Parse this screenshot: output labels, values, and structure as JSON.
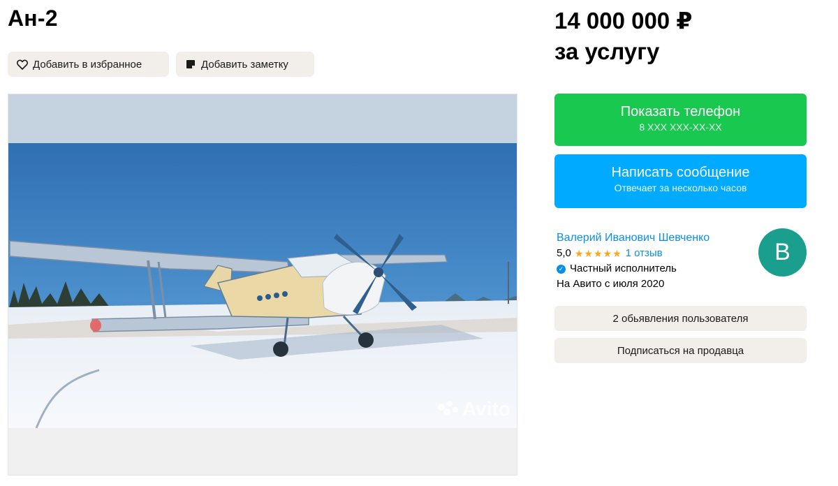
{
  "listing": {
    "title": "Ан-2",
    "favorite_label": "Добавить в избранное",
    "note_label": "Добавить заметку",
    "price_line1": "14 000 000 ₽",
    "price_line2": "за услугу",
    "photo_watermark": "Avito"
  },
  "actions": {
    "show_phone_label": "Показать телефон",
    "phone_masked": "8 XXX XXX-XX-XX",
    "message_label": "Написать сообщение",
    "message_sub": "Отвечает за несколько часов"
  },
  "seller": {
    "name": "Валерий Иванович Шевченко",
    "rating": "5,0",
    "stars": "★★★★★",
    "reviews": "1 отзыв",
    "type": "Частный исполнитель",
    "since": "На Авито с июля 2020",
    "avatar_letter": "В",
    "ads_label": "2 обьявления пользователя",
    "subscribe_label": "Подписаться на продавца"
  },
  "colors": {
    "phone_button": "#19c84f",
    "message_button": "#00aaff",
    "link": "#0a8ee8",
    "avatar": "#1a9f8e",
    "chip_bg": "#f2eeea"
  }
}
